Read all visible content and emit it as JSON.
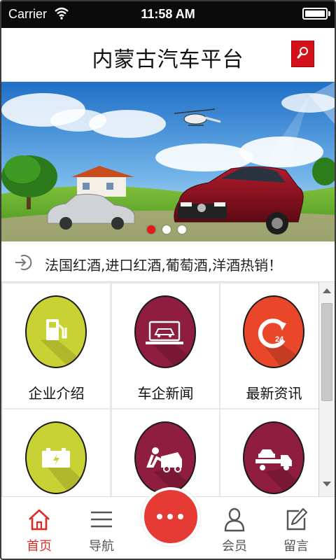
{
  "status_bar": {
    "carrier": "Carrier",
    "time": "11:58 AM",
    "battery_level": 1.0
  },
  "header": {
    "title": "内蒙古汽车平台",
    "search_icon": "search-icon",
    "accent": "#d4111b"
  },
  "banner": {
    "slide_count": 3,
    "active_slide": 1
  },
  "notice": {
    "icon": "enter-arrow-icon",
    "text": "法国红酒,进口红酒,葡萄酒,洋酒热销！"
  },
  "grid": {
    "items": [
      {
        "label": "企业介绍",
        "icon": "fuel-pump-icon",
        "color": "#c8d234"
      },
      {
        "label": "车企新闻",
        "icon": "laptop-car-icon",
        "color": "#8e1d3f"
      },
      {
        "label": "最新资讯",
        "icon": "24-hour-refresh-icon",
        "color": "#e9462a"
      },
      {
        "label": "",
        "icon": "car-battery-icon",
        "color": "#c8d234"
      },
      {
        "label": "",
        "icon": "car-repair-icon",
        "color": "#8e1d3f"
      },
      {
        "label": "",
        "icon": "tow-truck-icon",
        "color": "#8e1d3f"
      }
    ]
  },
  "tabbar": {
    "tabs": [
      {
        "label": "首页",
        "icon": "home-icon",
        "active": true
      },
      {
        "label": "导航",
        "icon": "menu-icon",
        "active": false
      },
      {
        "label": "会员",
        "icon": "user-icon",
        "active": false
      },
      {
        "label": "留言",
        "icon": "edit-icon",
        "active": false
      }
    ],
    "center_icon": "more-icon",
    "active_color": "#e02b24"
  }
}
